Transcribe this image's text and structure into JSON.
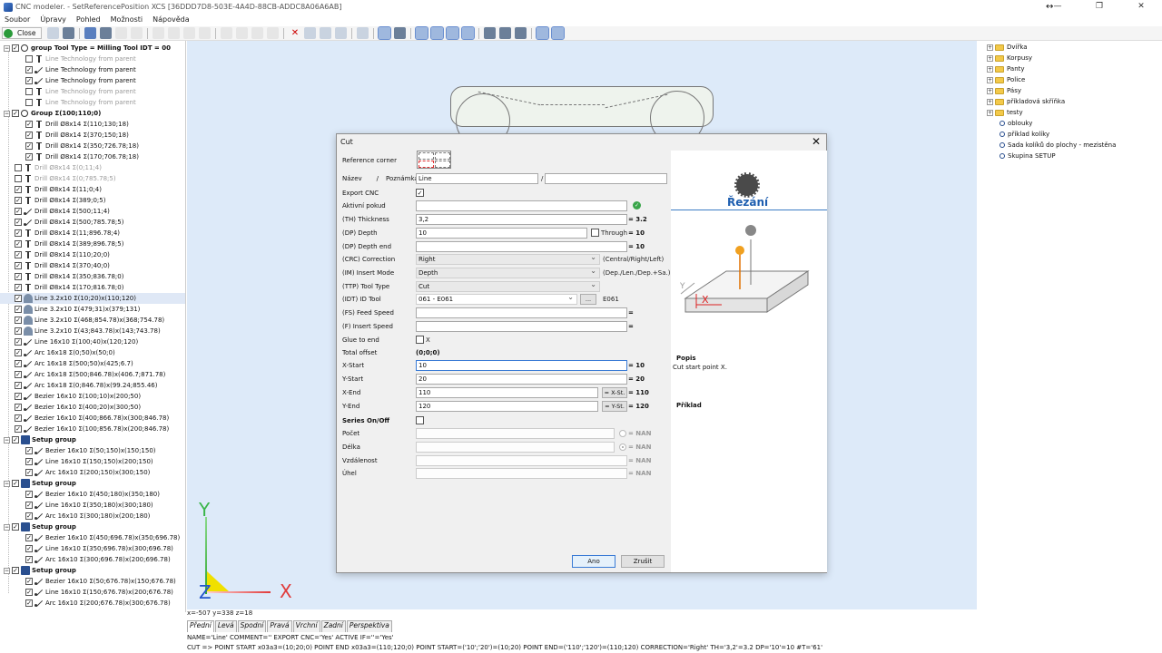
{
  "window": {
    "title": "CNC modeler. - SetReferencePosition XCS [36DDD7D8-503E-4A4D-88CB-ADDC8A06A6AB]",
    "controls": [
      "—",
      "❐",
      "✕"
    ],
    "resize_glyph": "↔"
  },
  "menu": [
    "Soubor",
    "Úpravy",
    "Pohled",
    "Možnosti",
    "Nápověda"
  ],
  "toolbar": {
    "close_label": "Close"
  },
  "tree": [
    {
      "label": "group  Tool Type = Milling  Tool IDT = 00",
      "group": true,
      "checked": true,
      "icon": "gear",
      "depth": 0
    },
    {
      "label": "Line Technology from parent",
      "checked": false,
      "dim": true,
      "icon": "drill",
      "depth": 2
    },
    {
      "label": "Line Technology from parent",
      "checked": true,
      "icon": "line",
      "depth": 2
    },
    {
      "label": "Line Technology from parent",
      "checked": true,
      "icon": "line",
      "depth": 2
    },
    {
      "label": "Line Technology from parent",
      "checked": false,
      "dim": true,
      "icon": "drill",
      "depth": 2
    },
    {
      "label": "Line Technology from parent",
      "checked": false,
      "dim": true,
      "icon": "drill",
      "depth": 2
    },
    {
      "label": "Group Σ(100;110;0)",
      "group": true,
      "checked": true,
      "icon": "gear",
      "depth": 0
    },
    {
      "label": "Drill Ø8x14 Σ(110;130;18)",
      "checked": true,
      "icon": "drill",
      "depth": 2
    },
    {
      "label": "Drill Ø8x14 Σ(370;150;18)",
      "checked": true,
      "icon": "drill",
      "depth": 2
    },
    {
      "label": "Drill Ø8x14 Σ(350;726.78;18)",
      "checked": true,
      "icon": "drill",
      "depth": 2
    },
    {
      "label": "Drill Ø8x14 Σ(170;706.78;18)",
      "checked": true,
      "icon": "drill",
      "depth": 2
    },
    {
      "label": "Drill Ø8x14 Σ(0;11;4)",
      "checked": false,
      "dim": true,
      "icon": "drill",
      "depth": 1
    },
    {
      "label": "Drill Ø8x14 Σ(0;785.78;5)",
      "checked": false,
      "dim": true,
      "icon": "drill",
      "depth": 1
    },
    {
      "label": "Drill Ø8x14 Σ(11;0;4)",
      "checked": true,
      "icon": "drill",
      "depth": 1
    },
    {
      "label": "Drill Ø8x14 Σ(389;0;5)",
      "checked": true,
      "icon": "drill",
      "depth": 1
    },
    {
      "label": "Drill Ø8x14 Σ(500;11;4)",
      "checked": true,
      "icon": "line",
      "depth": 1
    },
    {
      "label": "Drill Ø8x14 Σ(500;785.78;5)",
      "checked": true,
      "icon": "line",
      "depth": 1
    },
    {
      "label": "Drill Ø8x14 Σ(11;896.78;4)",
      "checked": true,
      "icon": "drill",
      "depth": 1
    },
    {
      "label": "Drill Ø8x14 Σ(389;896.78;5)",
      "checked": true,
      "icon": "drill",
      "depth": 1
    },
    {
      "label": "Drill Ø8x14 Σ(110;20;0)",
      "checked": true,
      "icon": "drill",
      "depth": 1
    },
    {
      "label": "Drill Ø8x14 Σ(370;40;0)",
      "checked": true,
      "icon": "drill",
      "depth": 1
    },
    {
      "label": "Drill Ø8x14 Σ(350;836.78;0)",
      "checked": true,
      "icon": "drill",
      "depth": 1
    },
    {
      "label": "Drill Ø8x14 Σ(170;816.78;0)",
      "checked": true,
      "icon": "drill",
      "depth": 1
    },
    {
      "label": "Line 3.2x10 Σ(10;20)x(110;120)",
      "checked": true,
      "icon": "round",
      "depth": 1,
      "selected": true
    },
    {
      "label": "Line 3.2x10 Σ(479;31)x(379;131)",
      "checked": true,
      "icon": "round",
      "depth": 1
    },
    {
      "label": "Line 3.2x10 Σ(468;854.78)x(368;754.78)",
      "checked": true,
      "icon": "round",
      "depth": 1
    },
    {
      "label": "Line 3.2x10 Σ(43;843.78)x(143;743.78)",
      "checked": true,
      "icon": "round",
      "depth": 1
    },
    {
      "label": "Line 16x10 Σ(100;40)x(120;120)",
      "checked": true,
      "icon": "line",
      "depth": 1
    },
    {
      "label": "Arc 16x18 Σ(0;50)x(50;0)",
      "checked": true,
      "icon": "line",
      "depth": 1
    },
    {
      "label": "Arc 16x18 Σ(500;50)x(425;6.7)",
      "checked": true,
      "icon": "line",
      "depth": 1
    },
    {
      "label": "Arc 16x18 Σ(500;846.78)x(406.7;871.78)",
      "checked": true,
      "icon": "line",
      "depth": 1
    },
    {
      "label": "Arc 16x18 Σ(0;846.78)x(99.24;855.46)",
      "checked": true,
      "icon": "line",
      "depth": 1
    },
    {
      "label": "Bezier 16x10 Σ(100;10)x(200;50)",
      "checked": true,
      "icon": "line",
      "depth": 1
    },
    {
      "label": "Bezier 16x10 Σ(400;20)x(300;50)",
      "checked": true,
      "icon": "line",
      "depth": 1
    },
    {
      "label": "Bezier 16x10 Σ(400;866.78)x(300;846.78)",
      "checked": true,
      "icon": "line",
      "depth": 1
    },
    {
      "label": "Bezier 16x10 Σ(100;856.78)x(200;846.78)",
      "checked": true,
      "icon": "line",
      "depth": 1
    },
    {
      "label": "Setup group",
      "group": true,
      "checked": true,
      "icon": "group-ic",
      "depth": 0
    },
    {
      "label": "Bezier 16x10 Σ(50;150)x(150;150)",
      "checked": true,
      "icon": "line",
      "depth": 2
    },
    {
      "label": "Line 16x10 Σ(150;150)x(200;150)",
      "checked": true,
      "icon": "line",
      "depth": 2
    },
    {
      "label": "Arc 16x10 Σ(200;150)x(300;150)",
      "checked": true,
      "icon": "line",
      "depth": 2
    },
    {
      "label": "Setup group",
      "group": true,
      "checked": true,
      "icon": "group-ic",
      "depth": 0
    },
    {
      "label": "Bezier 16x10 Σ(450;180)x(350;180)",
      "checked": true,
      "icon": "line",
      "depth": 2
    },
    {
      "label": "Line 16x10 Σ(350;180)x(300;180)",
      "checked": true,
      "icon": "line",
      "depth": 2
    },
    {
      "label": "Arc 16x10 Σ(300;180)x(200;180)",
      "checked": true,
      "icon": "line",
      "depth": 2
    },
    {
      "label": "Setup group",
      "group": true,
      "checked": true,
      "icon": "group-ic",
      "depth": 0
    },
    {
      "label": "Bezier 16x10 Σ(450;696.78)x(350;696.78)",
      "checked": true,
      "icon": "line",
      "depth": 2
    },
    {
      "label": "Line 16x10 Σ(350;696.78)x(300;696.78)",
      "checked": true,
      "icon": "line",
      "depth": 2
    },
    {
      "label": "Arc 16x10 Σ(300;696.78)x(200;696.78)",
      "checked": true,
      "icon": "line",
      "depth": 2
    },
    {
      "label": "Setup group",
      "group": true,
      "checked": true,
      "icon": "group-ic",
      "depth": 0
    },
    {
      "label": "Bezier 16x10 Σ(50;676.78)x(150;676.78)",
      "checked": true,
      "icon": "line",
      "depth": 2
    },
    {
      "label": "Line 16x10 Σ(150;676.78)x(200;676.78)",
      "checked": true,
      "icon": "line",
      "depth": 2
    },
    {
      "label": "Arc 16x10 Σ(200;676.78)x(300;676.78)",
      "checked": true,
      "icon": "line",
      "depth": 2
    }
  ],
  "library": [
    {
      "label": "Dvířka",
      "type": "folder"
    },
    {
      "label": "Korpusy",
      "type": "folder"
    },
    {
      "label": "Panty",
      "type": "folder"
    },
    {
      "label": "Police",
      "type": "folder"
    },
    {
      "label": "Pásy",
      "type": "folder"
    },
    {
      "label": "příkladová skříňka",
      "type": "folder"
    },
    {
      "label": "testy",
      "type": "folder"
    },
    {
      "label": "oblouky",
      "type": "item"
    },
    {
      "label": "příklad kolíky",
      "type": "item"
    },
    {
      "label": "Sada kolíků do plochy - mezistěna",
      "type": "item"
    },
    {
      "label": "Skupina SETUP",
      "type": "item"
    }
  ],
  "viewport": {
    "coords": "x=-507 y=338 z=18",
    "axis_y": "Y",
    "axis_z": "Z",
    "axis_x": "X",
    "view_tabs": [
      "Přední",
      "Levá",
      "Spodní",
      "Pravá",
      "Vrchní",
      "Zadní",
      "Perspektiva"
    ]
  },
  "status": {
    "line1": "NAME='Line'  COMMENT=''  EXPORT CNC='Yes'  ACTIVE IF=''='Yes'",
    "line2": "CUT =>  POINT START x03a3=(10;20;0)  POINT END x03a3=(110;120;0)  POINT START=('10';'20')=(10;20)  POINT END=('110';'120')=(110;120)  CORRECTION='Right'  TH='3,2'=3.2  DP='10'=10  #T='61'"
  },
  "dialog": {
    "title": "Cut",
    "close_glyph": "✕",
    "labels": {
      "ref_corner": "Reference corner",
      "name": "Název",
      "sep1": "/",
      "note": "Poznámka",
      "sep2": "/",
      "export": "Export CNC",
      "active": "Aktivní pokud",
      "thickness": "(TH) Thickness",
      "depth": "(DP) Depth",
      "depth_end": "(DP) Depth end",
      "correction": "(CRC) Correction",
      "insert_mode": "(IM) Insert Mode",
      "tool_type": "(TTP) Tool Type",
      "id_tool": "(IDT) ID Tool",
      "feed": "(FS) Feed Speed",
      "insert_speed": "(F) Insert Speed",
      "glue": "Glue to end",
      "total_offset": "Total offset",
      "x_start": "X-Start",
      "y_start": "Y-Start",
      "x_end": "X-End",
      "y_end": "Y-End",
      "series": "Series On/Off",
      "count": "Počet",
      "length": "Délka",
      "distance": "Vzdálenost",
      "angle": "Úhel",
      "through": "Through"
    },
    "values": {
      "name": "Line",
      "note": "",
      "active": "",
      "thickness": "3,2",
      "thickness_eval": "= 3.2",
      "depth": "10",
      "depth_eval": "= 10",
      "depth_end": "",
      "depth_end_eval": "= 10",
      "correction": "Right",
      "correction_hint": "(Central/Right/Left)",
      "insert_mode": "Depth",
      "insert_mode_hint": "(Dep./Len./Dep.+Sa.)",
      "tool_type": "Cut",
      "id_tool": "061 - E061",
      "id_tool_btn": "...",
      "id_tool_code": "E061",
      "feed": "",
      "feed_eval": "=",
      "insert_speed": "",
      "insert_speed_eval": "=",
      "glue_x": "X",
      "total_offset": "(0;0;0)",
      "x_start": "10",
      "x_start_eval": "= 10",
      "y_start": "20",
      "y_start_eval": "= 20",
      "x_end": "110",
      "x_end_btn": "= X-St.",
      "x_end_eval": "= 110",
      "y_end": "120",
      "y_end_btn": "= Y-St.",
      "y_end_eval": "= 120",
      "count_eval": "= NAN",
      "length_eval": "= NAN",
      "distance_eval": "= NAN",
      "angle_eval": "= NAN",
      "ok_check": "✓"
    },
    "buttons": {
      "ok": "Ano",
      "cancel": "Zrušit"
    },
    "illustration": {
      "title": "Řezání",
      "popis_heading": "Popis",
      "popis_text": "Cut start point X.",
      "priklad_heading": "Příklad",
      "axis_x": "X",
      "axis_y": "Y"
    }
  }
}
